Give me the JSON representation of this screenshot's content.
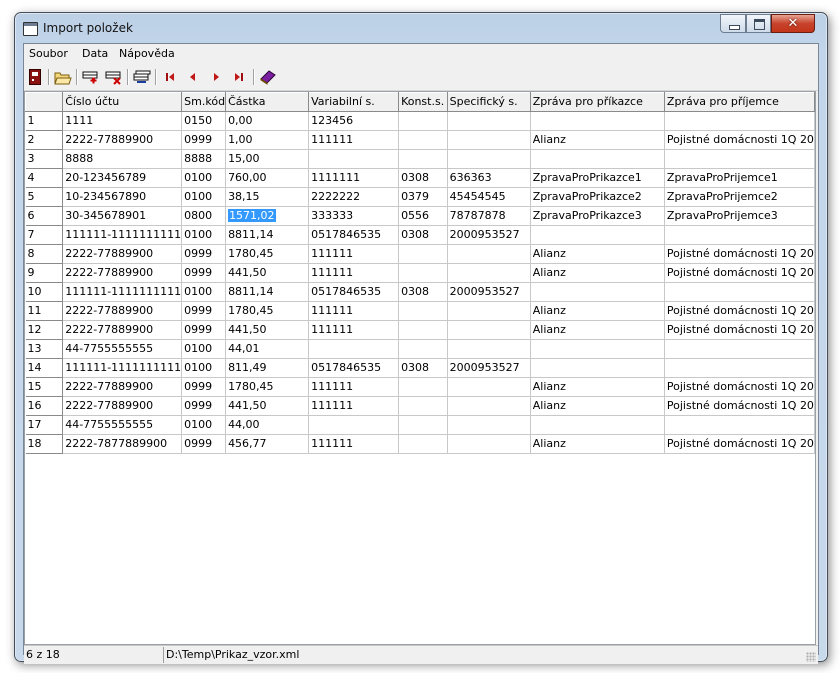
{
  "window": {
    "title": "Import položek"
  },
  "menu": [
    "Soubor",
    "Data",
    "Nápověda"
  ],
  "toolbar": {
    "icons": [
      "exit-icon",
      "open-folder-icon",
      "add-row-icon",
      "delete-row-icon",
      "import-icon",
      "first-record-icon",
      "prev-record-icon",
      "next-record-icon",
      "last-record-icon",
      "help-book-icon"
    ]
  },
  "grid": {
    "columns": [
      "Číslo účtu",
      "Sm.kód",
      "Částka",
      "Variabilní s.",
      "Konst.s.",
      "Specifický s.",
      "Zpráva pro příkazce",
      "Zpráva pro příjemce"
    ],
    "selected_row": 6,
    "selected_cell_text": "1571,02",
    "rows": [
      [
        "1",
        "1111",
        "0150",
        "0,00",
        "123456",
        "",
        "",
        "",
        ""
      ],
      [
        "2",
        "2222-77889900",
        "0999",
        "1,00",
        "111111",
        "",
        "",
        "Alianz",
        "Pojistné domácnosti 1Q 20"
      ],
      [
        "3",
        "8888",
        "8888",
        "15,00",
        "",
        "",
        "",
        "",
        ""
      ],
      [
        "4",
        "20-123456789",
        "0100",
        "760,00",
        "1111111",
        "0308",
        "636363",
        "ZpravaProPrikazce1",
        "ZpravaProPrijemce1"
      ],
      [
        "5",
        "10-234567890",
        "0100",
        "38,15",
        "2222222",
        "0379",
        "45454545",
        "ZpravaProPrikazce2",
        "ZpravaProPrijemce2"
      ],
      [
        "6",
        "30-345678901",
        "0800",
        "1571,02",
        "333333",
        "0556",
        "78787878",
        "ZpravaProPrikazce3",
        "ZpravaProPrijemce3"
      ],
      [
        "7",
        "111111-1111111111",
        "0100",
        "8811,14",
        "0517846535",
        "0308",
        "2000953527",
        "",
        ""
      ],
      [
        "8",
        "2222-77889900",
        "0999",
        "1780,45",
        "111111",
        "",
        "",
        "Alianz",
        "Pojistné domácnosti 1Q 20"
      ],
      [
        "9",
        "2222-77889900",
        "0999",
        "441,50",
        "111111",
        "",
        "",
        "Alianz",
        "Pojistné domácnosti 1Q 20"
      ],
      [
        "10",
        "111111-1111111111",
        "0100",
        "8811,14",
        "0517846535",
        "0308",
        "2000953527",
        "",
        ""
      ],
      [
        "11",
        "2222-77889900",
        "0999",
        "1780,45",
        "111111",
        "",
        "",
        "Alianz",
        "Pojistné domácnosti 1Q 20"
      ],
      [
        "12",
        "2222-77889900",
        "0999",
        "441,50",
        "111111",
        "",
        "",
        "Alianz",
        "Pojistné domácnosti 1Q 20"
      ],
      [
        "13",
        "44-7755555555",
        "0100",
        "44,01",
        "",
        "",
        "",
        "",
        ""
      ],
      [
        "14",
        "111111-1111111111",
        "0100",
        "811,49",
        "0517846535",
        "0308",
        "2000953527",
        "",
        ""
      ],
      [
        "15",
        "2222-77889900",
        "0999",
        "1780,45",
        "111111",
        "",
        "",
        "Alianz",
        "Pojistné domácnosti 1Q 20"
      ],
      [
        "16",
        "2222-77889900",
        "0999",
        "441,50",
        "111111",
        "",
        "",
        "Alianz",
        "Pojistné domácnosti 1Q 20"
      ],
      [
        "17",
        "44-7755555555",
        "0100",
        "44,00",
        "",
        "",
        "",
        "",
        ""
      ],
      [
        "18",
        "2222-7877889900",
        "0999",
        "456,77",
        "111111",
        "",
        "",
        "Alianz",
        "Pojistné domácnosti 1Q 20"
      ]
    ]
  },
  "status": {
    "position": "6 z 18",
    "file": "D:\\Temp\\Prikaz_vzor.xml"
  }
}
